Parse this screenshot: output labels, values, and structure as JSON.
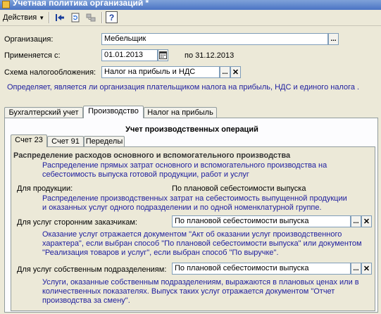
{
  "window": {
    "title": "Учетная политика организаций *"
  },
  "toolbar": {
    "actions_label": "Действия",
    "help_label": "?"
  },
  "header": {
    "org_label": "Организация:",
    "org_value": "Мебельщик",
    "applies_label": "Применяется с:",
    "applies_date": "01.01.2013",
    "applies_to": "по 31.12.2013",
    "tax_label": "Схема налогообложения:",
    "tax_value": "Налог на прибыль и НДС",
    "tax_hint": "Определяет, является ли организация плательщиком налога на прибыль, НДС и единого налога ."
  },
  "tabs": [
    "Бухгалтерский учет",
    "Производство",
    "Налог на прибыль"
  ],
  "production": {
    "section_title": "Учет производственных операций",
    "subtabs": [
      "Счет 23",
      "Счет 91",
      "Переделы"
    ],
    "group_title": "Распределение расходов основного и вспомогательного производства",
    "group_hint": "Распределение прямых затрат основного и вспомогательного производства на себестоимость выпуска готовой продукции, работ и услуг",
    "products_label": "Для продукции:",
    "products_value": "По плановой себестоимости выпуска",
    "products_hint": "Распределение производственных затрат на себестоимость выпущенной продукции и оказанных услуг одного подразделении и по одной номенклатурной группе.",
    "external_label": "Для услуг сторонним заказчикам:",
    "external_value": "По плановой себестоимости выпуска",
    "external_hint": "Оказание услуг отражается документом \"Акт об оказании услуг производственного характера\", если выбран способ \"По плановой себестоимости выпуска\" или документом \"Реализация товаров и услуг\", если выбран способ \"По выручке\".",
    "internal_label": "Для услуг собственным подразделениям:",
    "internal_value": "По плановой себестоимости выпуска",
    "internal_hint": "Услуги, оказанные собственным подразделениям, выражаются в плановых ценах или в количественных показателях. Выпуск таких услуг отражается документом \"Отчет производства за смену\"."
  }
}
